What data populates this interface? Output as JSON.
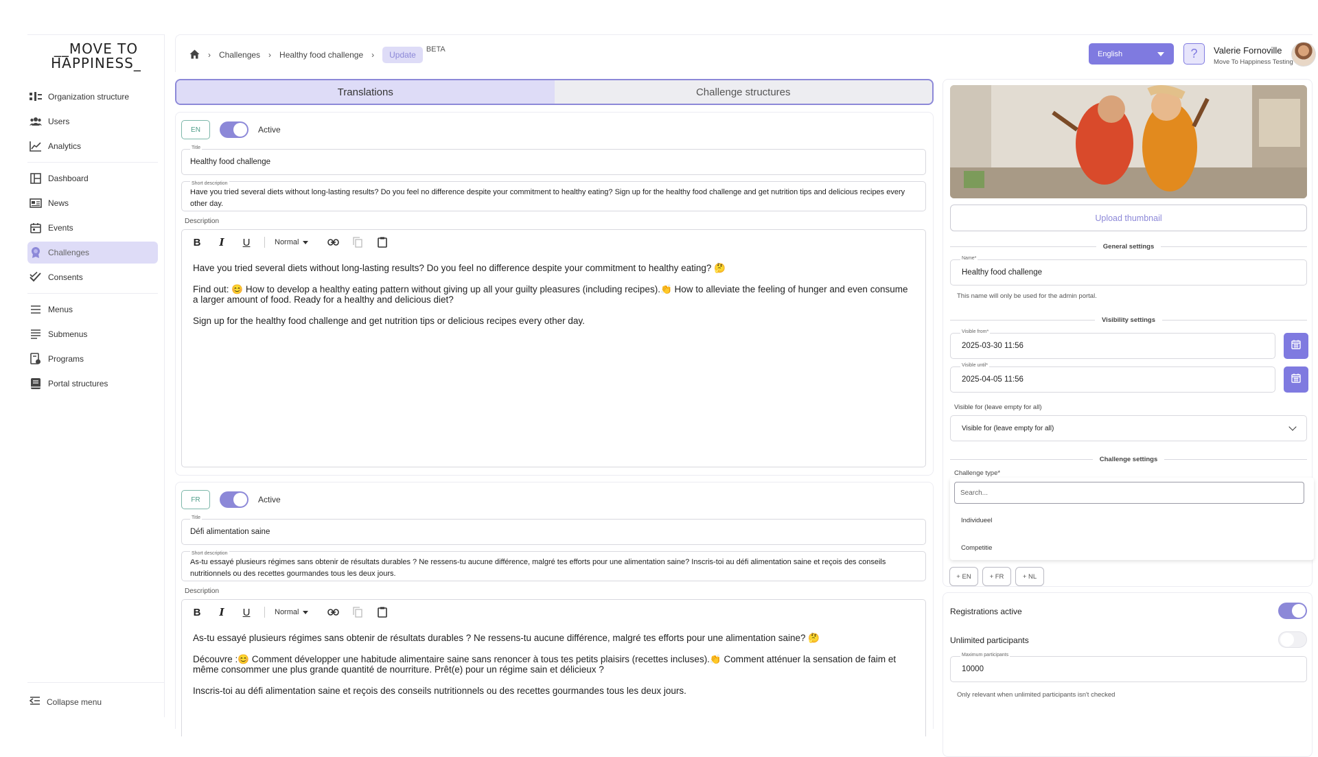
{
  "sidebar": {
    "logo_line1": "__MOVE TO",
    "logo_line2": "HAPPINESS_",
    "items": [
      {
        "label": "Organization structure",
        "icon": "org-structure-icon"
      },
      {
        "label": "Users",
        "icon": "users-icon"
      },
      {
        "label": "Analytics",
        "icon": "analytics-icon"
      },
      {
        "label": "Dashboard",
        "icon": "dashboard-icon"
      },
      {
        "label": "News",
        "icon": "news-icon"
      },
      {
        "label": "Events",
        "icon": "calendar-icon"
      },
      {
        "label": "Challenges",
        "icon": "medal-icon",
        "active": true
      },
      {
        "label": "Consents",
        "icon": "double-check-icon"
      },
      {
        "label": "Menus",
        "icon": "menu-icon"
      },
      {
        "label": "Submenus",
        "icon": "submenu-icon"
      },
      {
        "label": "Programs",
        "icon": "programs-icon"
      },
      {
        "label": "Portal structures",
        "icon": "book-icon"
      }
    ],
    "collapse_label": "Collapse menu"
  },
  "header": {
    "breadcrumb": [
      "Challenges",
      "Healthy food challenge",
      "Update"
    ],
    "beta": "BETA",
    "language": "English",
    "help": "?",
    "user_name": "Valerie Fornoville",
    "user_org": "Move To Happiness Testing"
  },
  "tabs": [
    "Translations",
    "Challenge structures"
  ],
  "translations": {
    "en": {
      "code": "EN",
      "active_label": "Active",
      "title_label": "Title",
      "title": "Healthy food challenge",
      "short_label": "Short description",
      "short": "Have you tried several diets without long-lasting results? Do you feel no difference despite your commitment to healthy eating? Sign up for the healthy food challenge and get nutrition tips and delicious recipes every other day.",
      "desc_label": "Description",
      "format": "Normal",
      "p1": "Have you tried several diets without long-lasting results? Do you feel no difference despite your commitment to healthy eating? 🤔",
      "p2": "Find out: 😊 How to develop a healthy eating pattern without giving up all your guilty pleasures (including recipes).👏 How to alleviate the feeling of hunger and even consume a larger amount of food. Ready for a healthy and delicious diet?",
      "p3": "Sign up for the healthy food challenge and get nutrition tips or delicious recipes every other day."
    },
    "fr": {
      "code": "FR",
      "active_label": "Active",
      "title_label": "Title",
      "title": "Défi alimentation saine",
      "short_label": "Short description",
      "short": "As-tu essayé plusieurs régimes sans obtenir de résultats durables ? Ne ressens-tu aucune différence, malgré tes efforts pour une alimentation saine? Inscris-toi au défi alimentation saine et reçois des conseils nutritionnels ou des recettes gourmandes tous les deux jours.",
      "desc_label": "Description",
      "format": "Normal",
      "p1": "As-tu essayé plusieurs régimes sans obtenir de résultats durables ? Ne ressens-tu aucune différence, malgré tes efforts pour une alimentation saine? 🤔",
      "p2": "Découvre :😊 Comment développer une habitude alimentaire saine sans renoncer à tous tes petits plaisirs (recettes incluses).👏 Comment atténuer la sensation de faim et même consommer une plus grande quantité de nourriture. Prêt(e) pour un régime sain et délicieux ?",
      "p3": "Inscris-toi au défi alimentation saine et reçois des conseils nutritionnels ou des recettes gourmandes tous les deux jours."
    }
  },
  "settings": {
    "upload_label": "Upload thumbnail",
    "general_title": "General settings",
    "name_label": "Name*",
    "name": "Healthy food challenge",
    "name_hint": "This name will only be used for the admin portal.",
    "visibility_title": "Visibility settings",
    "visible_from_label": "Visible from*",
    "visible_from": "2025-03-30 11:56",
    "visible_until_label": "Visible until*",
    "visible_until": "2025-04-05 11:56",
    "visible_for_label": "Visible for (leave empty for all)",
    "visible_for_placeholder": "Visible for (leave empty for all)",
    "challenge_title": "Challenge settings",
    "type_label": "Challenge type*",
    "search_placeholder": "Search...",
    "options": [
      "Individueel",
      "Competitie"
    ],
    "add_langs": [
      "+ EN",
      "+ FR",
      "+ NL"
    ],
    "registrations_label": "Registrations active",
    "registrations_active": true,
    "unlimited_label": "Unlimited participants",
    "unlimited_active": false,
    "max_label": "Maximum participants",
    "max_value": "10000",
    "max_hint": "Only relevant when unlimited participants isn't checked"
  },
  "colors": {
    "accent": "#7f7ae0",
    "accent_light": "#dedcf7",
    "badge": "#4d9c88"
  }
}
